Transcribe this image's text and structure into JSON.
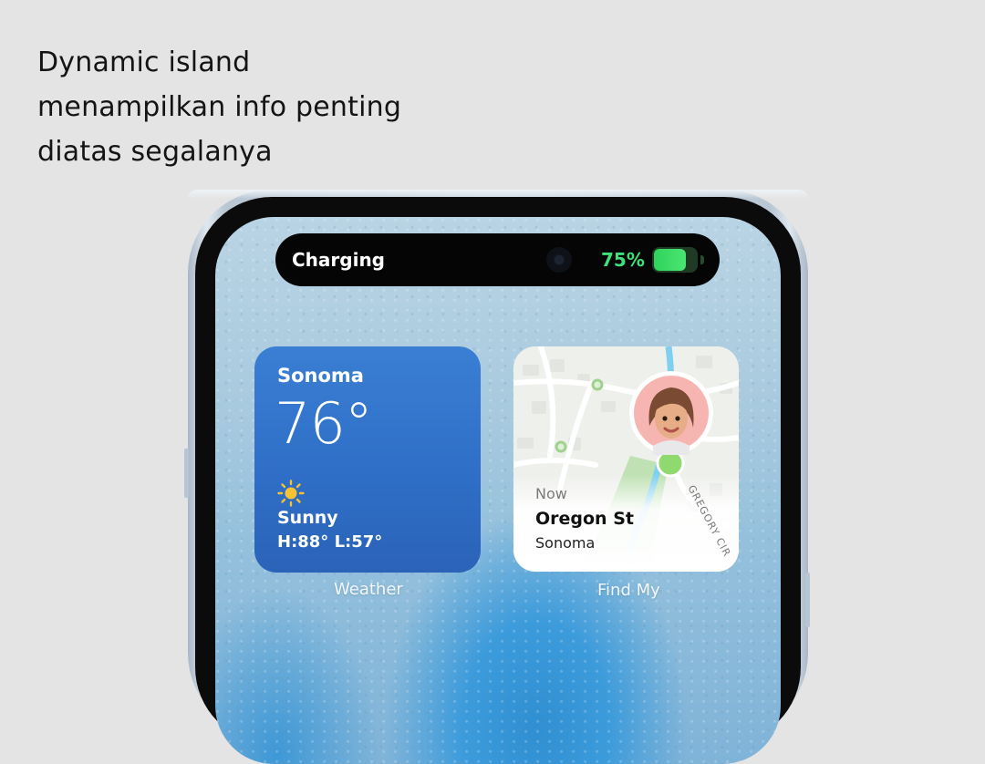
{
  "caption": {
    "line1": "Dynamic island",
    "line2": "menampilkan info penting",
    "line3": "diatas segalanya"
  },
  "island": {
    "status": "Charging",
    "battery_percent_label": "75%",
    "battery_level": 0.75,
    "battery_color": "#3ee07a"
  },
  "weather_widget": {
    "city": "Sonoma",
    "temperature": "76°",
    "condition": "Sunny",
    "high_low": "H:88° L:57°",
    "icon": "sun-icon",
    "app_label": "Weather"
  },
  "findmy_widget": {
    "time": "Now",
    "street": "Oregon St",
    "city": "Sonoma",
    "map_road_label": "GREGORY CIR",
    "app_label": "Find My"
  }
}
